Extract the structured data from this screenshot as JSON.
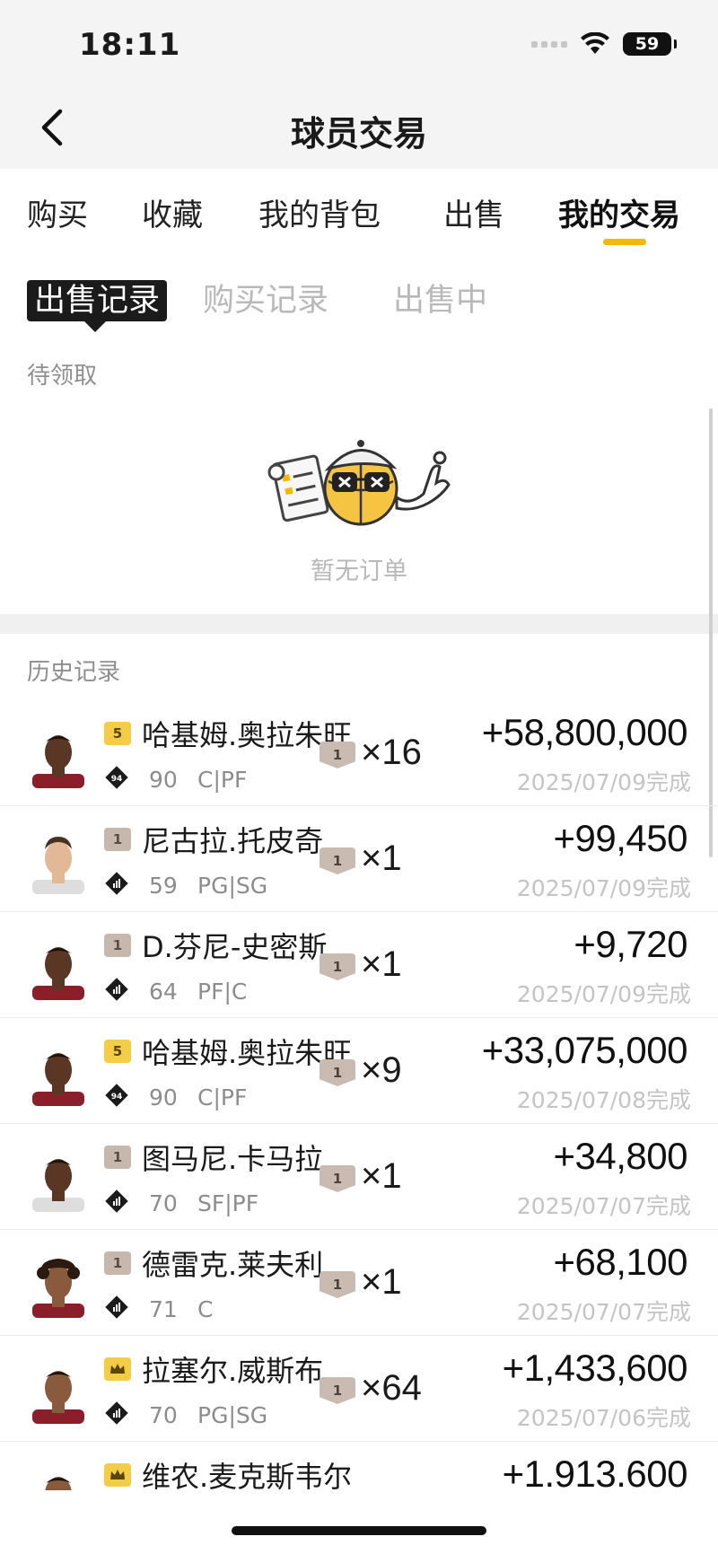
{
  "status_bar": {
    "time": "18:11",
    "battery": "59"
  },
  "nav": {
    "title": "球员交易"
  },
  "tabs": [
    {
      "label": "购买",
      "active": false
    },
    {
      "label": "收藏",
      "active": false
    },
    {
      "label": "我的背包",
      "active": false
    },
    {
      "label": "出售",
      "active": false
    },
    {
      "label": "我的交易",
      "active": true
    }
  ],
  "subtabs": [
    {
      "label": "出售记录",
      "active": true
    },
    {
      "label": "购买记录",
      "active": false
    },
    {
      "label": "出售中",
      "active": false
    }
  ],
  "pending": {
    "label": "待领取",
    "empty_text": "暂无订单"
  },
  "history": {
    "label": "历史记录",
    "records": [
      {
        "name": "哈基姆.奥拉朱旺",
        "tier": "5",
        "tier_style": "gold",
        "rating_icon": "94",
        "ovr": "90",
        "position": "C|PF",
        "grade": "1",
        "qty": "×16",
        "amount": "+58,800,000",
        "date": "2025/07/09完成",
        "skin": "dark"
      },
      {
        "name": "尼古拉.托皮奇",
        "tier": "1",
        "tier_style": "gray",
        "rating_icon": "bars-icon",
        "ovr": "59",
        "position": "PG|SG",
        "grade": "1",
        "qty": "×1",
        "amount": "+99,450",
        "date": "2025/07/09完成",
        "skin": "light"
      },
      {
        "name": "D.芬尼-史密斯",
        "tier": "1",
        "tier_style": "gray",
        "rating_icon": "bars-icon",
        "ovr": "64",
        "position": "PF|C",
        "grade": "1",
        "qty": "×1",
        "amount": "+9,720",
        "date": "2025/07/09完成",
        "skin": "dark"
      },
      {
        "name": "哈基姆.奥拉朱旺",
        "tier": "5",
        "tier_style": "gold",
        "rating_icon": "94",
        "ovr": "90",
        "position": "C|PF",
        "grade": "1",
        "qty": "×9",
        "amount": "+33,075,000",
        "date": "2025/07/08完成",
        "skin": "dark"
      },
      {
        "name": "图马尼.卡马拉",
        "tier": "1",
        "tier_style": "gray",
        "rating_icon": "bars-icon",
        "ovr": "70",
        "position": "SF|PF",
        "grade": "1",
        "qty": "×1",
        "amount": "+34,800",
        "date": "2025/07/07完成",
        "skin": "dark"
      },
      {
        "name": "德雷克.莱夫利",
        "tier": "1",
        "tier_style": "gray",
        "rating_icon": "bars-icon",
        "ovr": "71",
        "position": "C",
        "grade": "1",
        "qty": "×1",
        "amount": "+68,100",
        "date": "2025/07/07完成",
        "skin": "medium"
      },
      {
        "name": "拉塞尔.威斯布",
        "tier": "crown",
        "tier_style": "gold",
        "rating_icon": "bars-icon",
        "ovr": "70",
        "position": "PG|SG",
        "grade": "1",
        "qty": "×64",
        "amount": "+1,433,600",
        "date": "2025/07/06完成",
        "skin": "medium"
      },
      {
        "name": "维农.麦克斯韦尔",
        "tier": "crown",
        "tier_style": "gold",
        "rating_icon": "bars-icon",
        "ovr": "",
        "position": "",
        "grade": "",
        "qty": ", ,",
        "amount": "+1.913.600",
        "date": "",
        "skin": "medium"
      }
    ]
  },
  "colors": {
    "accent": "#f5b800",
    "muted": "#8f8f8f",
    "date": "#c4c4c4"
  }
}
